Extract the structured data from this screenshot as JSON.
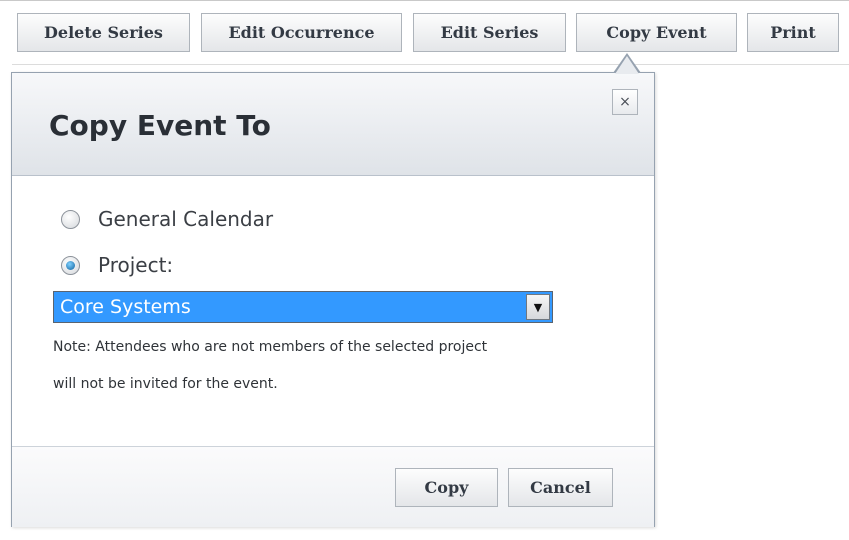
{
  "toolbar": {
    "buttons": [
      {
        "label": "Delete Series"
      },
      {
        "label": "Edit Occurrence"
      },
      {
        "label": "Edit Series"
      },
      {
        "label": "Copy Event"
      },
      {
        "label": "Print"
      }
    ]
  },
  "dialog": {
    "title": "Copy Event To",
    "close_glyph": "×",
    "options": [
      {
        "label": "General Calendar",
        "checked": false
      },
      {
        "label": "Project:",
        "checked": true
      }
    ],
    "project_select": {
      "value": "Core Systems",
      "arrow_icon": "▼",
      "selected_color": "#3399ff"
    },
    "note_line1": "Note: Attendees who are not members of the selected project",
    "note_line2": "will not be invited for the event.",
    "copy_label": "Copy",
    "cancel_label": "Cancel"
  }
}
